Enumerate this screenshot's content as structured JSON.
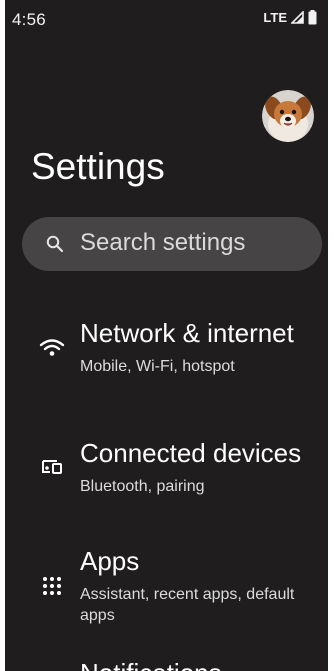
{
  "status_bar": {
    "time": "4:56",
    "network": "LTE"
  },
  "header": {
    "title": "Settings",
    "avatar_icon": "dog-photo-avatar"
  },
  "search": {
    "placeholder": "Search settings",
    "icon": "search-icon"
  },
  "items": [
    {
      "title": "Network & internet",
      "summary": "Mobile, Wi-Fi, hotspot",
      "icon": "wifi-icon"
    },
    {
      "title": "Connected devices",
      "summary": "Bluetooth, pairing",
      "icon": "connected-devices-icon"
    },
    {
      "title": "Apps",
      "summary": "Assistant, recent apps, default apps",
      "icon": "apps-grid-icon"
    },
    {
      "title": "Notifications",
      "icon": "notifications-icon"
    }
  ],
  "colors": {
    "background": "#1f1d1e",
    "search_background": "#474446",
    "text_primary": "#ffffff",
    "text_secondary": "#dcdcdc"
  }
}
